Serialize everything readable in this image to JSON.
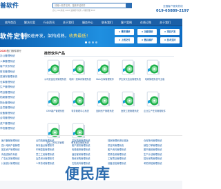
{
  "header": {
    "brand": "普软件",
    "search_placeholder": "请输入软件名称，搜索本站软件",
    "hot_words": "办公 OA系统 CRM 进销存 财务 人事管理 ERP",
    "tagline": "全国客户服务热线",
    "phone": "019-65889-2197"
  },
  "nav": {
    "items": [
      "软件首页",
      "解决方案",
      "行业资讯",
      "关于我们",
      "服务中心",
      "联系我们",
      "客户案例",
      "在线订购",
      "关于我们"
    ]
  },
  "banner": {
    "title": "软件定制",
    "slogan_pre": "极速开发，架构成熟，",
    "slogan_hl": "收费最低！",
    "tiles": [
      "★ 需求调研",
      "★ 功能规划",
      "★ 项目开发",
      "★ 上线交付",
      "★ 售后维护",
      "★ 技术支持"
    ],
    "slides": 4
  },
  "sidebar": {
    "year": "2023",
    "title_rest": "热门软件排行",
    "items": [
      "办公管理系统",
      "人事管理系统",
      "客户关系系统",
      "财务管理系统",
      "进销存管理系统",
      "仓库管理系统",
      "生产管理系统",
      "项目管理系统",
      "档案管理系统",
      "物业管理系统",
      "会员管理系统",
      "设备管理系统",
      "合同管理系统",
      "资产管理系统",
      "学校管理系统"
    ]
  },
  "products": {
    "title": "推荐软件产品",
    "items": [
      "公司资金往来管理系统",
      "电网一类库存管理系统",
      "Web仓库管理软件",
      "学生家长信息管理系统",
      "电网管理系统专业版",
      "CRM客户管理系统",
      "事务管理中心系统",
      "固网资产管理系统",
      "医院工程管理系统",
      "企业生产任务管理软件",
      "学生工作情况管理",
      "教育服务管理系统"
    ],
    "disc_color": "#20b24c",
    "ribbon_color": "#18a3d8"
  },
  "footer": {
    "columns": [
      [
        "医疗器械管理系统",
        "四川电网产值管理",
        "固定资产管理系统",
        "商品进销存系统",
        "广告业务管理系统",
        "计划统计管理系统"
      ],
      [
        "合同档案管理系统",
        "库存盘点管理软件",
        "车辆智能管理系统",
        "员工工资管理系统",
        "会员积分管理软件",
        "人事劳动管理系统"
      ],
      [
        "监狱档案管理系统",
        "客户服务管理系统",
        "电梯维修管理系统",
        "酒店客房管理系统",
        "物资采购管理系统",
        "文档资料管理系统"
      ],
      [
        "档案管理系统标准版",
        "供应商管理系统",
        "客户资料管理系统",
        "质量检测管理系统",
        "工程项目管理系统",
        "设备巡检管理系统"
      ],
      [
        "仓库条码管理系统",
        "销售订单管理系统",
        "图书借阅管理系统",
        "生产计划管理系统",
        "招标采购管理系统",
        "考勤排班管理系统"
      ]
    ]
  },
  "watermark": "便民库"
}
